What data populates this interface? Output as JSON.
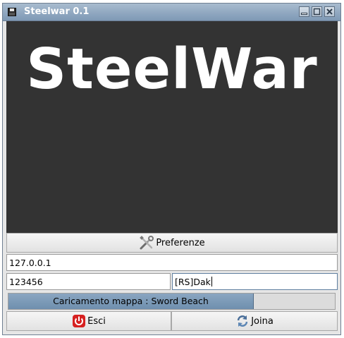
{
  "window": {
    "title": "Steelwar 0.1"
  },
  "banner": {
    "logo_text": "SteelWar"
  },
  "preferences_button": {
    "label": "Preferenze",
    "icon": "tools-icon"
  },
  "server_address": {
    "value": "127.0.0.1"
  },
  "port": {
    "value": "123456"
  },
  "player_name": {
    "value": "[RS]Dak"
  },
  "loading": {
    "label": "Caricamento mappa : Sword Beach",
    "progress": 0.75
  },
  "exit_button": {
    "label": "Esci",
    "icon": "power-icon",
    "color": "#d62020"
  },
  "join_button": {
    "label": "Joina",
    "icon": "refresh-icon"
  },
  "colors": {
    "banner_bg": "#333333",
    "titlebar": "#8ea6bf",
    "progress_fill": "#7a97b5"
  }
}
